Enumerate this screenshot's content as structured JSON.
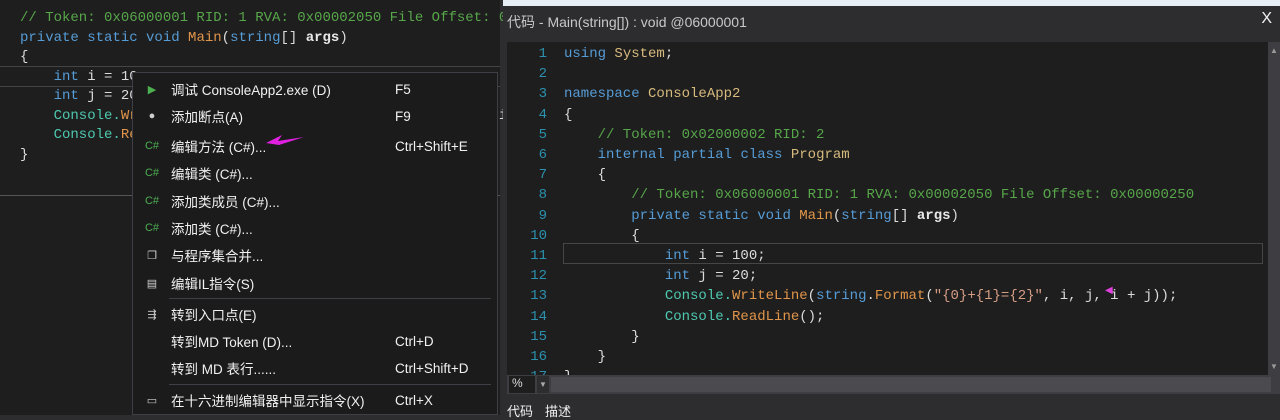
{
  "left_code": [
    [
      [
        "// Token: 0x06000001 RID: 1 RVA: 0x00002050 File Offset: 0x00000250",
        "cm"
      ]
    ],
    [
      [
        "private ",
        "kw"
      ],
      [
        "static ",
        "kw"
      ],
      [
        "void ",
        "kw"
      ],
      [
        "Main",
        "me"
      ],
      [
        "(",
        "pl"
      ],
      [
        "string",
        "kw"
      ],
      [
        "[] ",
        "pl"
      ],
      [
        "args",
        "bd"
      ],
      [
        ")",
        "pl"
      ]
    ],
    [
      [
        "{",
        "pl"
      ]
    ],
    [
      [
        "    int ",
        "kw"
      ],
      [
        "i = 10;",
        "pl"
      ]
    ],
    [
      [
        "    int ",
        "kw"
      ],
      [
        "j = 20;",
        "pl"
      ]
    ],
    [
      [
        "    Console.",
        "ty"
      ],
      [
        "WriteLine",
        "me"
      ],
      [
        "(string.Format(\"{0}+{1}={2}\", i, j, i + j));",
        "pl"
      ]
    ],
    [
      [
        "    Console.",
        "ty"
      ],
      [
        "ReadLine",
        "me"
      ],
      [
        "();",
        "pl"
      ]
    ],
    [
      [
        "}",
        "pl"
      ]
    ]
  ],
  "context_menu": [
    {
      "icon": "play-icon",
      "glyph": "▶",
      "label": "调试 ConsoleApp2.exe (D)",
      "shortcut": "F5"
    },
    {
      "icon": "breakpoint-icon",
      "glyph": "●",
      "label": "添加断点(A)",
      "shortcut": "F9"
    },
    {
      "icon": "csharp-icon",
      "glyph": "C#",
      "label": "编辑方法 (C#)...",
      "shortcut": "Ctrl+Shift+E"
    },
    {
      "icon": "csharp-icon",
      "glyph": "C#",
      "label": "编辑类 (C#)...",
      "shortcut": ""
    },
    {
      "icon": "csharp-icon",
      "glyph": "C#",
      "label": "添加类成员 (C#)...",
      "shortcut": ""
    },
    {
      "icon": "csharp-icon",
      "glyph": "C#",
      "label": "添加类 (C#)...",
      "shortcut": ""
    },
    {
      "icon": "merge-assembly-icon",
      "glyph": "❐",
      "label": "与程序集合并...",
      "shortcut": ""
    },
    {
      "icon": "il-instructions-icon",
      "glyph": "▤",
      "label": "编辑IL指令(S)",
      "shortcut": ""
    },
    {
      "icon": "entry-point-icon",
      "glyph": "⇶",
      "label": "转到入口点(E)",
      "shortcut": ""
    },
    {
      "icon": "",
      "glyph": "",
      "label": "转到MD Token (D)...",
      "shortcut": "Ctrl+D"
    },
    {
      "icon": "",
      "glyph": "",
      "label": "转到 MD 表行......",
      "shortcut": "Ctrl+Shift+D"
    },
    {
      "icon": "hex-editor-icon",
      "glyph": "▭",
      "label": "在十六进制编辑器中显示指令(X)",
      "shortcut": "Ctrl+X"
    }
  ],
  "right_panel": {
    "title": "代码 - Main(string[]) : void @06000001",
    "close": "X",
    "zoom": "%",
    "tabs": [
      "代码",
      "描述"
    ]
  },
  "right_code": [
    [
      [
        "using ",
        "kw"
      ],
      [
        "System",
        "yl"
      ],
      [
        ";",
        "pl"
      ]
    ],
    [],
    [
      [
        "namespace ",
        "kw"
      ],
      [
        "ConsoleApp2",
        "yl"
      ]
    ],
    [
      [
        "{",
        "pl"
      ]
    ],
    [
      [
        "    // Token: 0x02000002 RID: 2",
        "cm"
      ]
    ],
    [
      [
        "    internal ",
        "kw"
      ],
      [
        "partial ",
        "kw"
      ],
      [
        "class ",
        "kw"
      ],
      [
        "Program",
        "yl"
      ]
    ],
    [
      [
        "    {",
        "pl"
      ]
    ],
    [
      [
        "        // Token: 0x06000001 RID: 1 RVA: 0x00002050 File Offset: 0x00000250",
        "cm"
      ]
    ],
    [
      [
        "        private ",
        "kw"
      ],
      [
        "static ",
        "kw"
      ],
      [
        "void ",
        "kw"
      ],
      [
        "Main",
        "me"
      ],
      [
        "(",
        "pl"
      ],
      [
        "string",
        "kw"
      ],
      [
        "[] ",
        "pl"
      ],
      [
        "args",
        "bd"
      ],
      [
        ")",
        "pl"
      ]
    ],
    [
      [
        "        {",
        "pl"
      ]
    ],
    [
      [
        "            int ",
        "kw"
      ],
      [
        "i = 100;",
        "pl"
      ]
    ],
    [
      [
        "            int ",
        "kw"
      ],
      [
        "j = 20;",
        "pl"
      ]
    ],
    [
      [
        "            Console.",
        "ty"
      ],
      [
        "WriteLine",
        "me"
      ],
      [
        "(",
        "pl"
      ],
      [
        "string",
        "kw"
      ],
      [
        ".",
        "pl"
      ],
      [
        "Format",
        "me"
      ],
      [
        "(",
        "pl"
      ],
      [
        "\"{0}+{1}={2}\"",
        "st"
      ],
      [
        ", i, j, i + j));",
        "pl"
      ]
    ],
    [
      [
        "            Console.",
        "ty"
      ],
      [
        "ReadLine",
        "me"
      ],
      [
        "();",
        "pl"
      ]
    ],
    [
      [
        "        }",
        "pl"
      ]
    ],
    [
      [
        "    }",
        "pl"
      ]
    ],
    [
      [
        "}",
        "pl"
      ]
    ]
  ]
}
